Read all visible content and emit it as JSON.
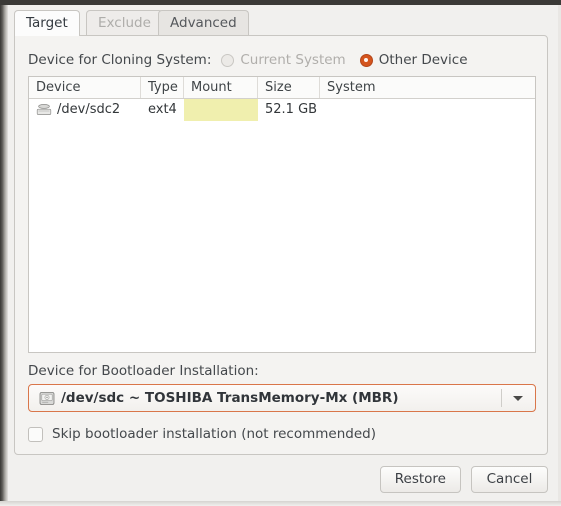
{
  "tabs": [
    {
      "label": "Target",
      "state": "active"
    },
    {
      "label": "Exclude",
      "state": "disabled"
    },
    {
      "label": "Advanced",
      "state": "inactive"
    }
  ],
  "cloning": {
    "label": "Device for Cloning System:",
    "options": [
      {
        "label": "Current System",
        "selected": false,
        "disabled": true
      },
      {
        "label": "Other Device",
        "selected": true,
        "disabled": false
      }
    ]
  },
  "table": {
    "columns": [
      "Device",
      "Type",
      "Mount",
      "Size",
      "System"
    ],
    "rows": [
      {
        "icon": "drive-icon",
        "device": "/dev/sdc2",
        "type": "ext4",
        "mount": "",
        "size": "52.1 GB",
        "system": ""
      }
    ]
  },
  "bootloader": {
    "label": "Device for Bootloader Installation:",
    "selected": "/dev/sdc ~ TOSHIBA TransMemory-Mx (MBR)",
    "icon": "hard-disk-icon",
    "arrow": "chevron-down-icon"
  },
  "skip": {
    "label": "Skip bootloader installation (not recommended)",
    "checked": false
  },
  "footer": {
    "restore_label": "Restore",
    "cancel_label": "Cancel"
  },
  "colors": {
    "accent": "#d4541d",
    "combo_border": "#d9764a",
    "mount_highlight": "#f0efae",
    "panel_bg": "#f4f3f1",
    "window_bg": "#f1f0ee"
  }
}
